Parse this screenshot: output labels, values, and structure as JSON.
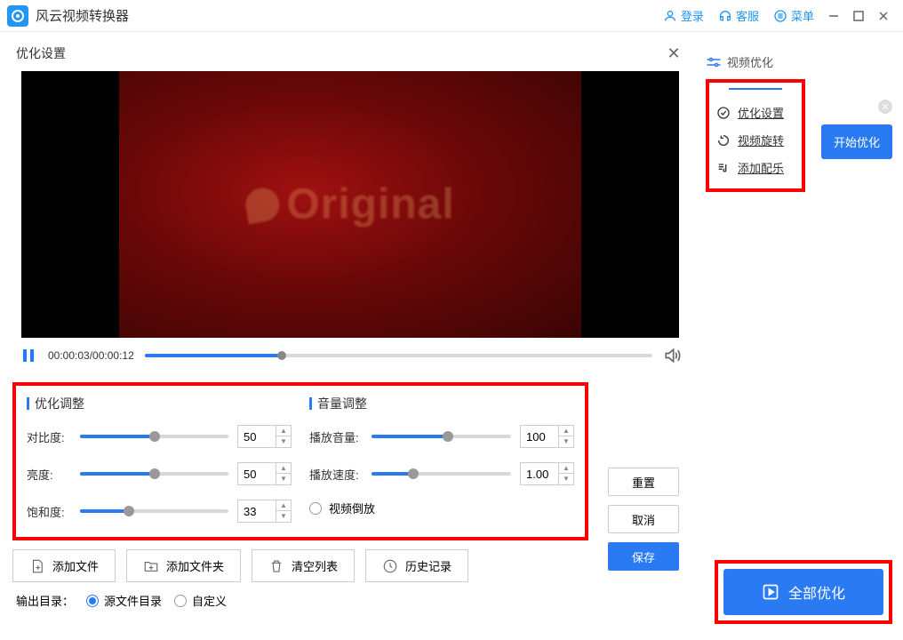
{
  "app": {
    "title": "风云视频转换器"
  },
  "titlebar": {
    "login": "登录",
    "support": "客服",
    "menu": "菜单"
  },
  "rightPanel": {
    "tabLabel": "视频优化",
    "items": [
      {
        "label": "优化设置"
      },
      {
        "label": "视频旋转"
      },
      {
        "label": "添加配乐"
      }
    ],
    "startBtn": "开始优化"
  },
  "modal": {
    "title": "优化设置",
    "videoOverlay": "Original",
    "time": "00:00:03/00:00:12",
    "progressPct": 27
  },
  "adjust": {
    "leftTitle": "优化调整",
    "rightTitle": "音量调整",
    "contrast": {
      "label": "对比度:",
      "value": "50",
      "pct": 50
    },
    "brightness": {
      "label": "亮度:",
      "value": "50",
      "pct": 50
    },
    "saturation": {
      "label": "饱和度:",
      "value": "33",
      "pct": 33
    },
    "volume": {
      "label": "播放音量:",
      "value": "100",
      "pct": 55
    },
    "speed": {
      "label": "播放速度:",
      "value": "1.00",
      "pct": 30
    },
    "reverse": "视频倒放"
  },
  "actions": {
    "reset": "重置",
    "cancel": "取消",
    "save": "保存"
  },
  "toolbar": {
    "addFile": "添加文件",
    "addFolder": "添加文件夹",
    "clearList": "清空列表",
    "history": "历史记录"
  },
  "output": {
    "label": "输出目录：",
    "sourceDir": "源文件目录",
    "custom": "自定义"
  },
  "bigBtn": "全部优化"
}
